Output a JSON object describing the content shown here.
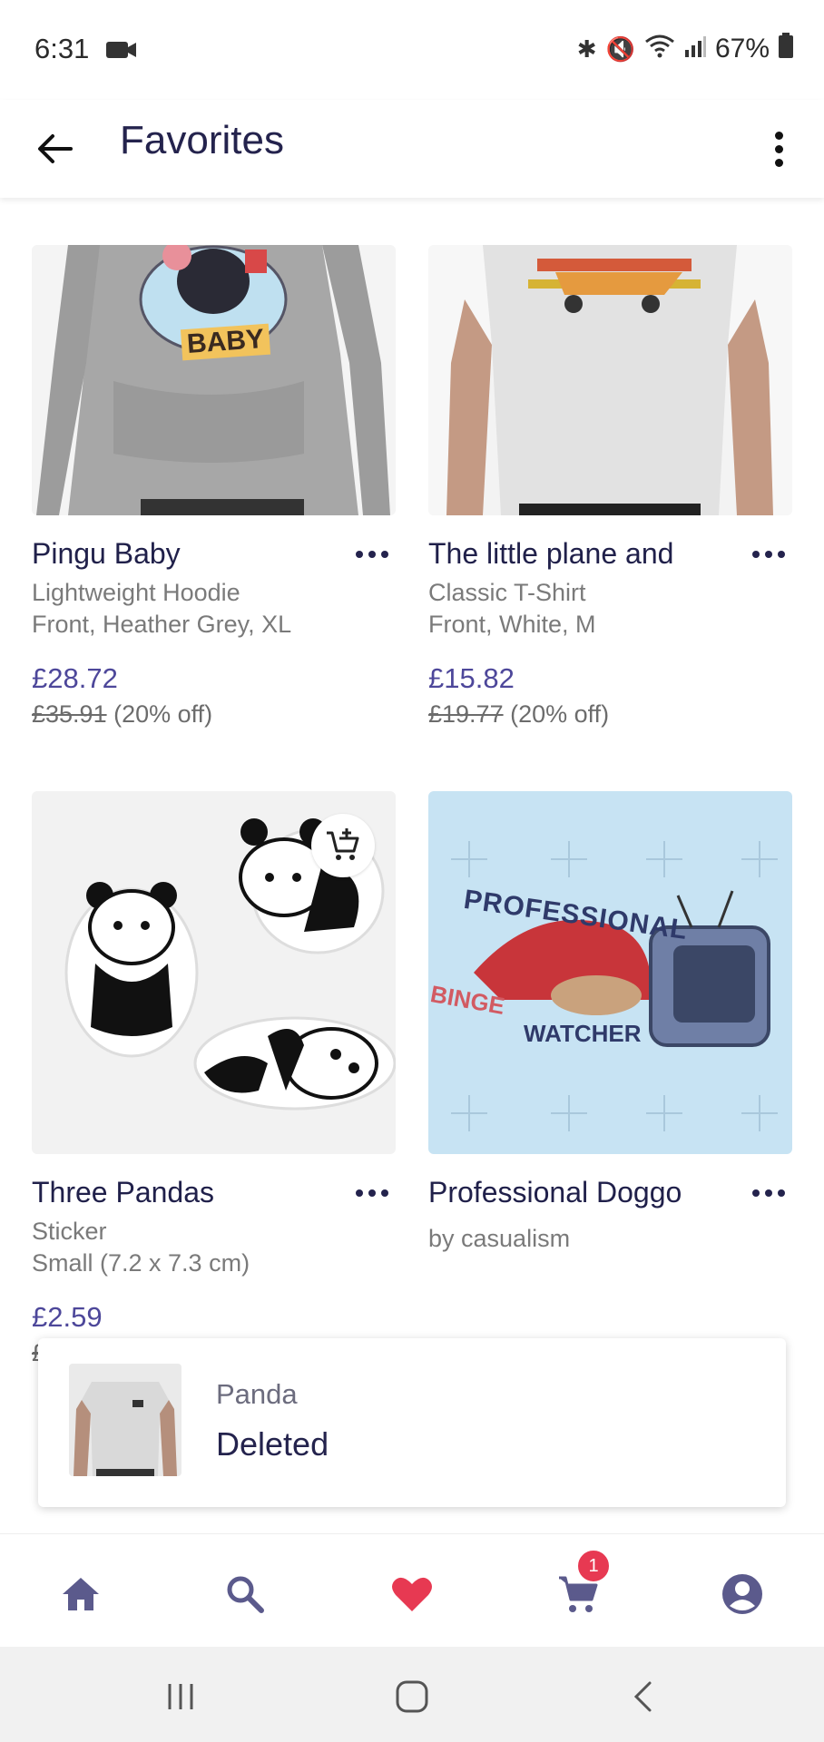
{
  "status_bar": {
    "time": "6:31",
    "battery": "67%"
  },
  "app_bar": {
    "title": "Favorites"
  },
  "products": [
    {
      "title": "Pingu Baby",
      "subtitle1": "Lightweight Hoodie",
      "subtitle2": "Front, Heather Grey, XL",
      "price": "£28.72",
      "old_price": "£35.91",
      "discount": "(20% off)",
      "art_text": "BABY"
    },
    {
      "title": "The little plane and",
      "subtitle1": "Classic T-Shirt",
      "subtitle2": "Front, White, M",
      "price": "£15.82",
      "old_price": "£19.77",
      "discount": "(20% off)"
    },
    {
      "title": "Three Pandas",
      "subtitle1": "Sticker",
      "subtitle2": "Small (7.2 x 7.3 cm)",
      "price": "£2.59",
      "old_price_partial": "£"
    },
    {
      "title": "Professional Doggo",
      "subtitle1": "by casualism",
      "art_text_top": "PROFESSIONAL",
      "art_text_left": "BINGE",
      "art_text_bottom": "WATCHER"
    }
  ],
  "snackbar": {
    "name": "Panda",
    "status": "Deleted"
  },
  "bottom_nav": {
    "cart_badge": "1"
  },
  "colors": {
    "accent": "#4d479a",
    "heart": "#e73952",
    "nav_icon": "#5b5a8c"
  }
}
